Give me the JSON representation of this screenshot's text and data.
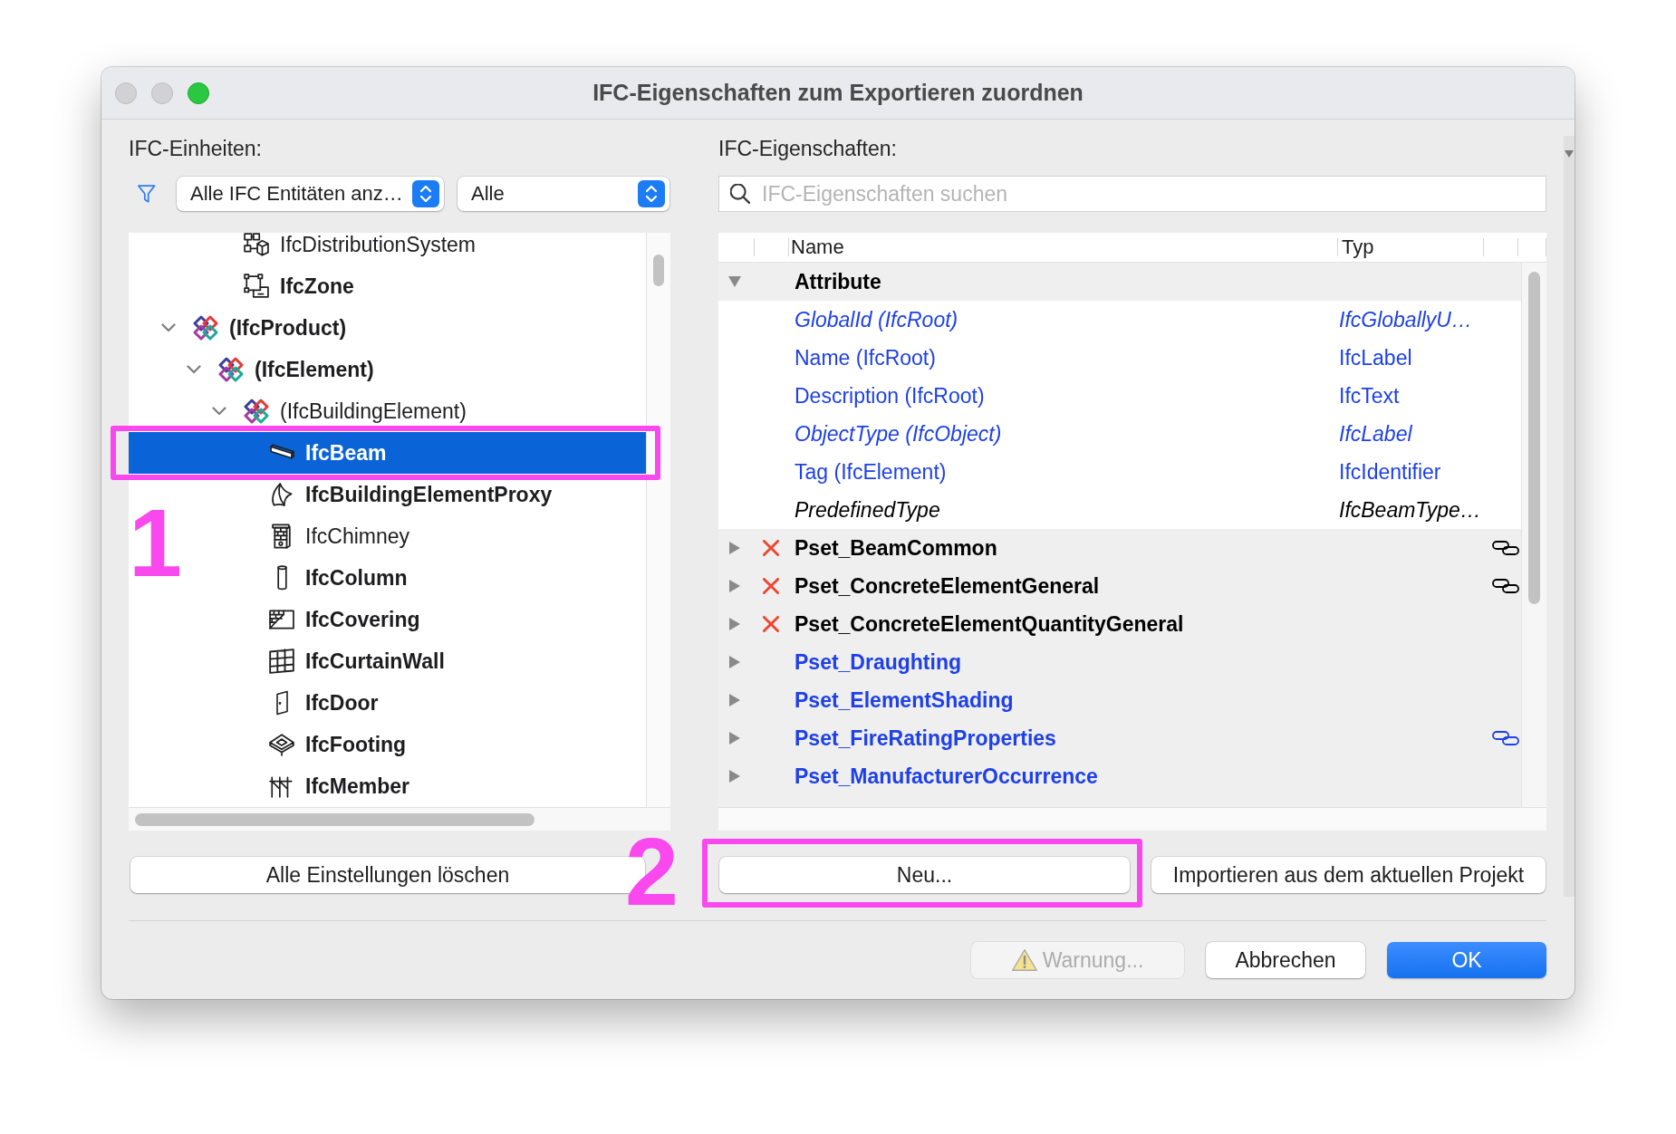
{
  "window": {
    "title": "IFC-Eigenschaften zum Exportieren zuordnen",
    "controls": [
      {
        "kind": "close",
        "disabled": true
      },
      {
        "kind": "minimize",
        "disabled": true
      },
      {
        "kind": "zoom",
        "disabled": false
      }
    ]
  },
  "entities": {
    "label": "IFC-Einheiten:",
    "filters": [
      {
        "value": "Alle IFC Entitäten anz…"
      },
      {
        "value": "Alle"
      }
    ],
    "tree": [
      {
        "children": [
          {
            "children": [
              {
                "label": "IfcDistributionSystem",
                "kind": "system",
                "bold": false,
                "selected": false
              },
              {
                "label": "IfcZone",
                "kind": "zone",
                "bold": true,
                "selected": false
              }
            ]
          }
        ]
      },
      {
        "label": "(IfcProduct)",
        "kind": "abstract",
        "bold": true,
        "selected": false,
        "expanded": true,
        "children": [
          {
            "label": "(IfcElement)",
            "kind": "abstract",
            "bold": true,
            "selected": false,
            "expanded": true,
            "children": [
              {
                "label": "(IfcBuildingElement)",
                "kind": "abstract",
                "bold": false,
                "selected": false,
                "expanded": true,
                "children": [
                  {
                    "label": "IfcBeam",
                    "kind": "beam",
                    "bold": true,
                    "selected": true
                  },
                  {
                    "label": "IfcBuildingElementProxy",
                    "kind": "proxy",
                    "bold": true,
                    "selected": false
                  },
                  {
                    "label": "IfcChimney",
                    "kind": "chimney",
                    "bold": false,
                    "selected": false
                  },
                  {
                    "label": "IfcColumn",
                    "kind": "column",
                    "bold": true,
                    "selected": false
                  },
                  {
                    "label": "IfcCovering",
                    "kind": "covering",
                    "bold": true,
                    "selected": false
                  },
                  {
                    "label": "IfcCurtainWall",
                    "kind": "curtainwall",
                    "bold": true,
                    "selected": false
                  },
                  {
                    "label": "IfcDoor",
                    "kind": "door",
                    "bold": true,
                    "selected": false
                  },
                  {
                    "label": "IfcFooting",
                    "kind": "footing",
                    "bold": true,
                    "selected": false
                  },
                  {
                    "label": "IfcMember",
                    "kind": "member",
                    "bold": true,
                    "selected": false
                  }
                ]
              }
            ]
          }
        ]
      }
    ],
    "button": "Alle Einstellungen löschen"
  },
  "properties": {
    "label": "IFC-Eigenschaften:",
    "search": {
      "placeholder": "IFC-Eigenschaften suchen"
    },
    "columns": [
      "Name",
      "Typ"
    ],
    "groups": [
      {
        "name": "Attribute",
        "expanded": true,
        "error": false,
        "linked": false,
        "color": "#000000",
        "children": [
          {
            "name": "GlobalId (IfcRoot)",
            "type": "IfcGloballyU…",
            "italic": true,
            "color": "#1e40e8"
          },
          {
            "name": "Name (IfcRoot)",
            "type": "IfcLabel",
            "italic": false,
            "color": "#1e40e8"
          },
          {
            "name": "Description (IfcRoot)",
            "type": "IfcText",
            "italic": false,
            "color": "#1e40e8"
          },
          {
            "name": "ObjectType (IfcObject)",
            "type": "IfcLabel",
            "italic": true,
            "color": "#1e40e8"
          },
          {
            "name": "Tag (IfcElement)",
            "type": "IfcIdentifier",
            "italic": false,
            "color": "#1e40e8"
          },
          {
            "name": "PredefinedType",
            "type": "IfcBeamType…",
            "italic": true,
            "color": "#000000"
          }
        ]
      },
      {
        "name": "Pset_BeamCommon",
        "expanded": false,
        "error": true,
        "linked": true,
        "color": "#000000"
      },
      {
        "name": "Pset_ConcreteElementGeneral",
        "expanded": false,
        "error": true,
        "linked": true,
        "color": "#000000"
      },
      {
        "name": "Pset_ConcreteElementQuantityGeneral",
        "expanded": false,
        "error": true,
        "linked": false,
        "color": "#000000"
      },
      {
        "name": "Pset_Draughting",
        "expanded": false,
        "error": false,
        "linked": false,
        "color": "#1e40e8"
      },
      {
        "name": "Pset_ElementShading",
        "expanded": false,
        "error": false,
        "linked": false,
        "color": "#1e40e8"
      },
      {
        "name": "Pset_FireRatingProperties",
        "expanded": false,
        "error": false,
        "linked": true,
        "color": "#1e40e8"
      },
      {
        "name": "Pset_ManufacturerOccurrence",
        "expanded": false,
        "error": false,
        "linked": false,
        "color": "#1e40e8"
      }
    ],
    "buttons": [
      "Neu...",
      "Importieren aus dem aktuellen Projekt"
    ]
  },
  "footer_buttons": [
    {
      "label": "Warnung...",
      "kind": "warning",
      "disabled": true,
      "default": false
    },
    {
      "label": "Abbrechen",
      "kind": "cancel",
      "disabled": false,
      "default": false
    },
    {
      "label": "OK",
      "kind": "confirm",
      "disabled": false,
      "default": true
    }
  ],
  "annotations": [
    {
      "label": "1"
    },
    {
      "label": "2"
    }
  ]
}
